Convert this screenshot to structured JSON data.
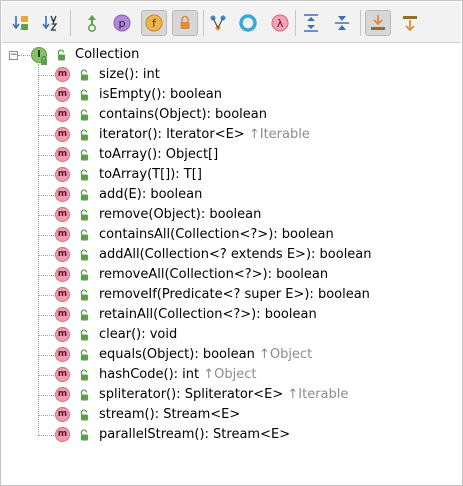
{
  "toolbar": {
    "buttons": [
      {
        "name": "sort-by-visibility-button",
        "icon": "sort-visibility-icon",
        "active": false
      },
      {
        "name": "sort-alphabetically-button",
        "icon": "sort-alpha-icon",
        "active": false
      },
      {
        "name": "show-inherited-button",
        "icon": "inherited-icon",
        "active": false
      },
      {
        "name": "show-properties-button",
        "icon": "property-icon",
        "glyph": "p",
        "active": false
      },
      {
        "name": "show-fields-button",
        "icon": "field-icon",
        "glyph": "f",
        "active": true
      },
      {
        "name": "show-non-public-button",
        "icon": "lock-icon",
        "active": true
      },
      {
        "name": "show-anonymous-classes-button",
        "icon": "anonymous-icon",
        "active": false
      },
      {
        "name": "show-lambdas-ring-button",
        "icon": "ring-icon",
        "active": false
      },
      {
        "name": "show-lambdas-button",
        "icon": "lambda-icon",
        "glyph": "λ",
        "active": false
      },
      {
        "name": "expand-all-button",
        "icon": "expand-all-icon",
        "active": false
      },
      {
        "name": "collapse-all-button",
        "icon": "collapse-all-icon",
        "active": false
      },
      {
        "name": "autoscroll-to-source-button",
        "icon": "autoscroll-to-source-icon",
        "active": true
      },
      {
        "name": "autoscroll-from-source-button",
        "icon": "autoscroll-from-source-icon",
        "active": false
      }
    ]
  },
  "tree": {
    "root": {
      "label": "Collection",
      "badge": "I"
    },
    "members": [
      {
        "sig": "size(): int",
        "inherited": ""
      },
      {
        "sig": "isEmpty(): boolean",
        "inherited": ""
      },
      {
        "sig": "contains(Object): boolean",
        "inherited": ""
      },
      {
        "sig": "iterator(): Iterator<E>",
        "inherited": "↑Iterable"
      },
      {
        "sig": "toArray(): Object[]",
        "inherited": ""
      },
      {
        "sig": "toArray(T[]): T[]",
        "inherited": ""
      },
      {
        "sig": "add(E): boolean",
        "inherited": ""
      },
      {
        "sig": "remove(Object): boolean",
        "inherited": ""
      },
      {
        "sig": "containsAll(Collection<?>): boolean",
        "inherited": ""
      },
      {
        "sig": "addAll(Collection<? extends E>): boolean",
        "inherited": ""
      },
      {
        "sig": "removeAll(Collection<?>): boolean",
        "inherited": ""
      },
      {
        "sig": "removeIf(Predicate<? super E>): boolean",
        "inherited": ""
      },
      {
        "sig": "retainAll(Collection<?>): boolean",
        "inherited": ""
      },
      {
        "sig": "clear(): void",
        "inherited": ""
      },
      {
        "sig": "equals(Object): boolean",
        "inherited": "↑Object"
      },
      {
        "sig": "hashCode(): int",
        "inherited": "↑Object"
      },
      {
        "sig": "spliterator(): Spliterator<E>",
        "inherited": "↑Iterable"
      },
      {
        "sig": "stream(): Stream<E>",
        "inherited": ""
      },
      {
        "sig": "parallelStream(): Stream<E>",
        "inherited": ""
      }
    ],
    "method_badge": "m"
  },
  "colors": {
    "method_badge": "#f29cb0",
    "interface_badge": "#8ac06a",
    "lock_green": "#59a24a",
    "inherited_text": "#8c8c8c"
  }
}
